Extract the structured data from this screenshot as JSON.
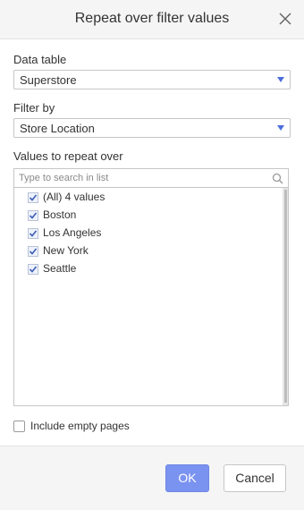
{
  "dialog": {
    "title": "Repeat over filter values"
  },
  "data_table": {
    "label": "Data table",
    "value": "Superstore"
  },
  "filter_by": {
    "label": "Filter by",
    "value": "Store Location"
  },
  "values": {
    "label": "Values to repeat over",
    "search_placeholder": "Type to search in list",
    "items": [
      {
        "label": "(All) 4 values",
        "checked": true
      },
      {
        "label": "Boston",
        "checked": true
      },
      {
        "label": "Los Angeles",
        "checked": true
      },
      {
        "label": "New York",
        "checked": true
      },
      {
        "label": "Seattle",
        "checked": true
      }
    ]
  },
  "include_empty": {
    "label": "Include empty pages",
    "checked": false
  },
  "footer": {
    "ok_label": "OK",
    "cancel_label": "Cancel"
  },
  "colors": {
    "accent": "#7b93f0",
    "dropdown_arrow": "#4a6edb",
    "header_bg": "#f5f5f5"
  },
  "icons": {
    "close": "close-icon",
    "dropdown": "chevron-down-icon",
    "search": "search-icon",
    "check": "checkmark-icon"
  }
}
